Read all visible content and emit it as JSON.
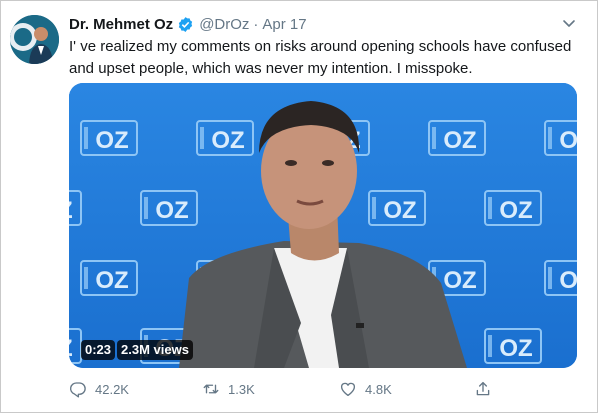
{
  "tweet": {
    "author_name": "Dr. Mehmet Oz",
    "handle": "@DrOz",
    "separator": "·",
    "date": "Apr 17",
    "text": "I' ve realized my comments on risks around opening schools have confused and upset people, which was never my intention. I misspoke.",
    "verified": true
  },
  "media": {
    "backdrop_logo_text": "OZ",
    "duration": "0:23",
    "views": "2.3M views",
    "backdrop_color": "#1f78d8"
  },
  "actions": {
    "replies": "42.2K",
    "retweets": "1.3K",
    "likes": "4.8K"
  },
  "icons": {
    "reply": "reply-icon",
    "retweet": "retweet-icon",
    "like": "heart-icon",
    "share": "share-icon",
    "caret": "chevron-down-icon",
    "verified": "verified-badge-icon"
  },
  "colors": {
    "accent": "#1da1f2",
    "muted": "#657786",
    "text": "#14171a"
  }
}
